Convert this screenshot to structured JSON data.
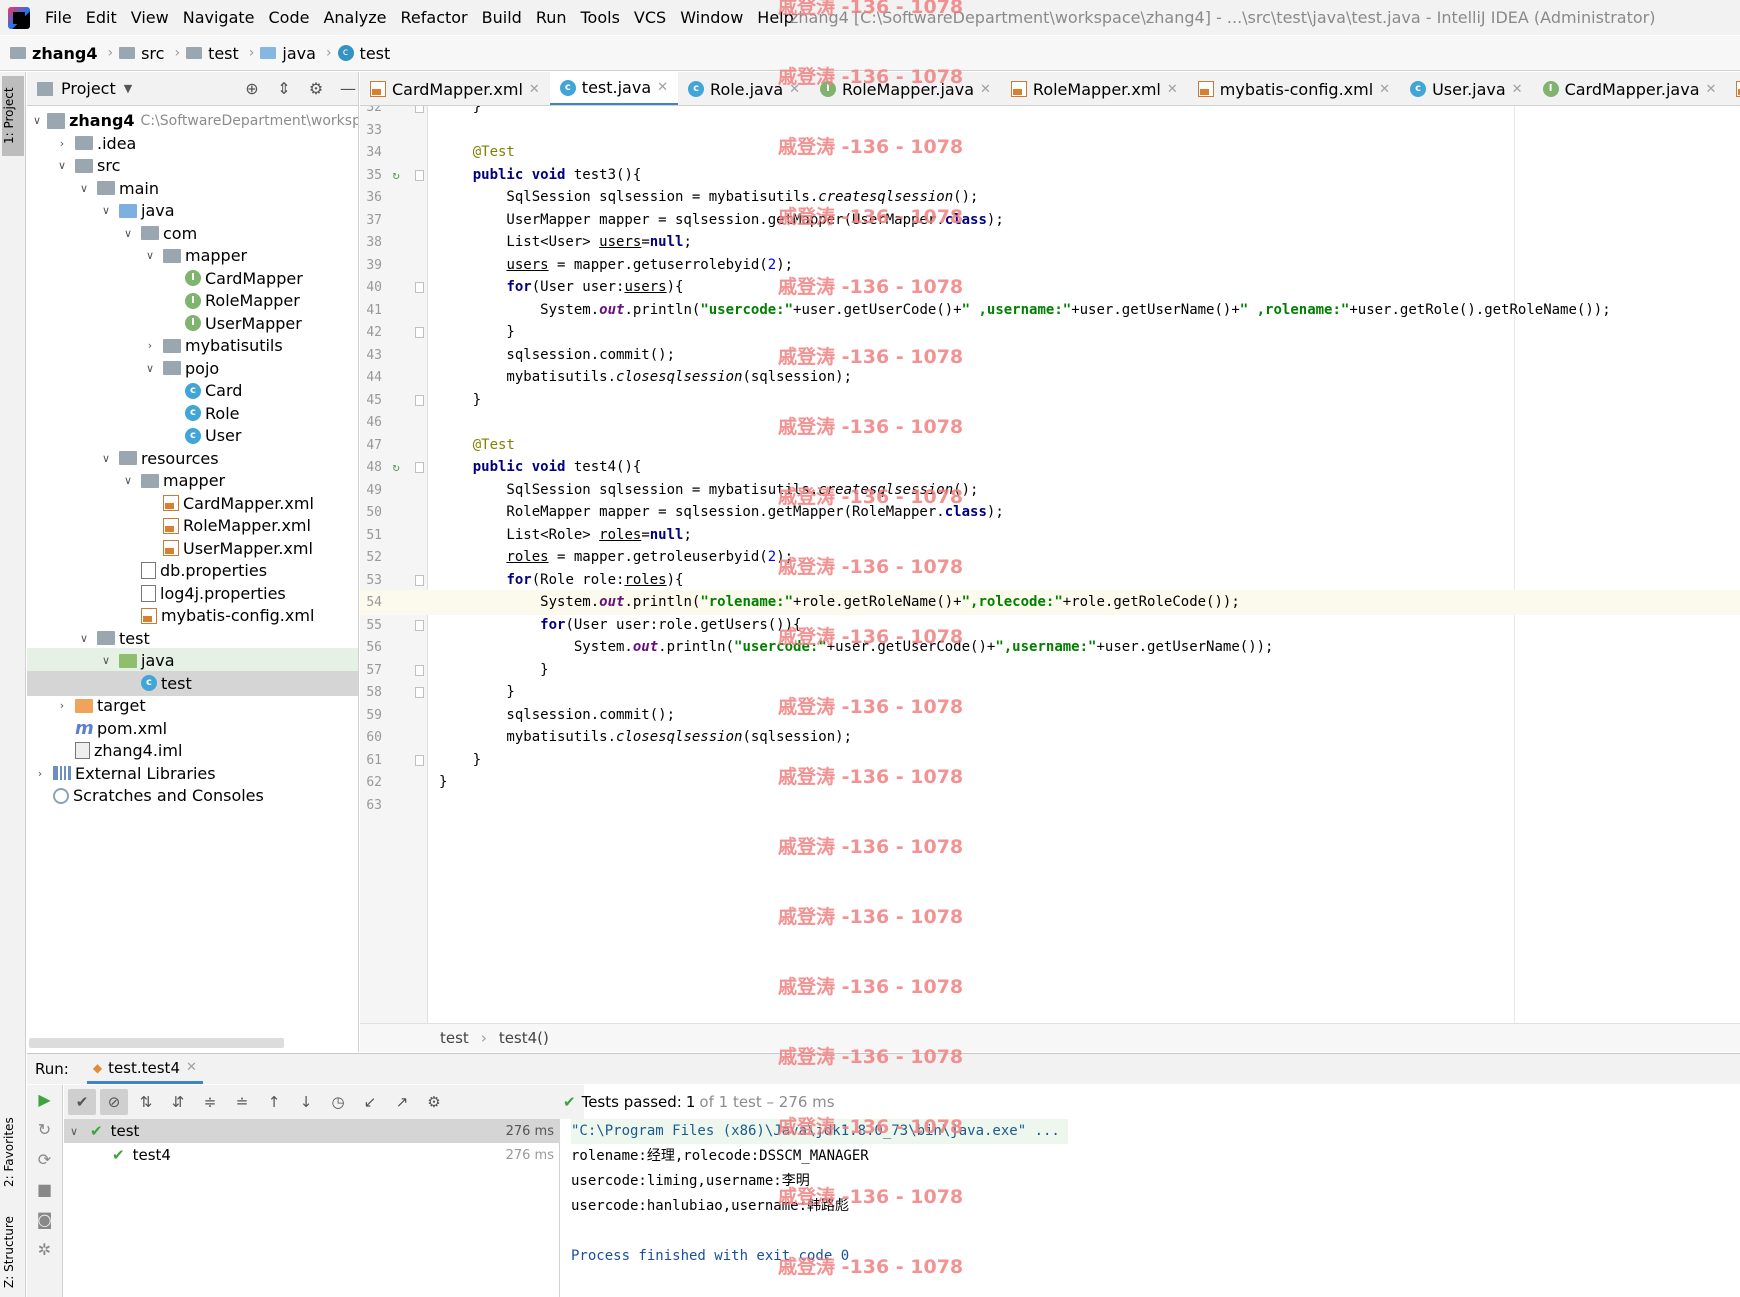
{
  "window_title": "zhang4 [C:\\SoftwareDepartment\\workspace\\zhang4] - ...\\src\\test\\java\\test.java - IntelliJ IDEA (Administrator)",
  "menu": [
    "File",
    "Edit",
    "View",
    "Navigate",
    "Code",
    "Analyze",
    "Refactor",
    "Build",
    "Run",
    "Tools",
    "VCS",
    "Window",
    "Help"
  ],
  "breadcrumb": [
    "zhang4",
    "src",
    "test",
    "java",
    "test"
  ],
  "left_strip": {
    "project": "1: Project",
    "favorites": "2: Favorites",
    "structure": "Z: Structure"
  },
  "project_panel": {
    "title": "Project",
    "tree": [
      {
        "label": "zhang4",
        "path": "C:\\SoftwareDepartment\\workspace\\zhang4",
        "icon": "module-icon"
      },
      {
        "label": ".idea",
        "icon": "folder-icon"
      },
      {
        "label": "src",
        "icon": "folder-icon"
      },
      {
        "label": "main",
        "icon": "folder-icon"
      },
      {
        "label": "java",
        "icon": "source-folder-icon"
      },
      {
        "label": "com",
        "icon": "package-icon"
      },
      {
        "label": "mapper",
        "icon": "package-icon"
      },
      {
        "label": "CardMapper",
        "icon": "interface-icon"
      },
      {
        "label": "RoleMapper",
        "icon": "interface-icon"
      },
      {
        "label": "UserMapper",
        "icon": "interface-icon"
      },
      {
        "label": "mybatisutils",
        "icon": "package-icon"
      },
      {
        "label": "pojo",
        "icon": "package-icon"
      },
      {
        "label": "Card",
        "icon": "class-icon"
      },
      {
        "label": "Role",
        "icon": "class-icon"
      },
      {
        "label": "User",
        "icon": "class-icon"
      },
      {
        "label": "resources",
        "icon": "resources-folder-icon"
      },
      {
        "label": "mapper",
        "icon": "folder-icon"
      },
      {
        "label": "CardMapper.xml",
        "icon": "xml-file-icon"
      },
      {
        "label": "RoleMapper.xml",
        "icon": "xml-file-icon"
      },
      {
        "label": "UserMapper.xml",
        "icon": "xml-file-icon"
      },
      {
        "label": "db.properties",
        "icon": "properties-file-icon"
      },
      {
        "label": "log4j.properties",
        "icon": "properties-file-icon"
      },
      {
        "label": "mybatis-config.xml",
        "icon": "xml-file-icon"
      },
      {
        "label": "test",
        "icon": "folder-icon"
      },
      {
        "label": "java",
        "icon": "test-folder-icon"
      },
      {
        "label": "test",
        "icon": "class-icon"
      },
      {
        "label": "target",
        "icon": "excluded-folder-icon"
      },
      {
        "label": "pom.xml",
        "icon": "maven-icon"
      },
      {
        "label": "zhang4.iml",
        "icon": "iml-file-icon"
      },
      {
        "label": "External Libraries",
        "icon": "library-icon"
      },
      {
        "label": "Scratches and Consoles",
        "icon": "scratch-icon"
      }
    ]
  },
  "tabs": [
    {
      "label": "CardMapper.xml",
      "icon": "xml-file-icon"
    },
    {
      "label": "test.java",
      "icon": "class-icon",
      "active": true
    },
    {
      "label": "Role.java",
      "icon": "class-icon"
    },
    {
      "label": "RoleMapper.java",
      "icon": "interface-icon"
    },
    {
      "label": "RoleMapper.xml",
      "icon": "xml-file-icon"
    },
    {
      "label": "mybatis-config.xml",
      "icon": "xml-file-icon"
    },
    {
      "label": "User.java",
      "icon": "class-icon"
    },
    {
      "label": "CardMapper.java",
      "icon": "interface-icon"
    },
    {
      "label": "UserMa",
      "icon": "xml-file-icon"
    }
  ],
  "editor": {
    "line_numbers": [
      "32",
      "33",
      "34",
      "35",
      "36",
      "37",
      "38",
      "39",
      "40",
      "41",
      "42",
      "43",
      "44",
      "45",
      "46",
      "47",
      "48",
      "49",
      "50",
      "51",
      "52",
      "53",
      "54",
      "55",
      "56",
      "57",
      "58",
      "59",
      "60",
      "61",
      "62",
      "63"
    ],
    "current_line": "54",
    "crumb": [
      "test",
      "test4()"
    ]
  },
  "run": {
    "label": "Run:",
    "tab": "test.test4",
    "status_prefix": "Tests passed:",
    "status_count": "1",
    "status_suffix": "of 1 test – 276 ms",
    "tests": [
      {
        "name": "test",
        "time": "276 ms"
      },
      {
        "name": "test4",
        "time": "276 ms"
      }
    ],
    "console": [
      "\"C:\\Program Files (x86)\\Java\\jdk1.8.0_73\\bin\\java.exe\" ...",
      "rolename:经理,rolecode:DSSCM_MANAGER",
      "usercode:liming,username:李明",
      "usercode:hanlubiao,username:韩路彪",
      "",
      "Process finished with exit code 0"
    ]
  },
  "watermark": "戚登涛 -136 - 1078"
}
